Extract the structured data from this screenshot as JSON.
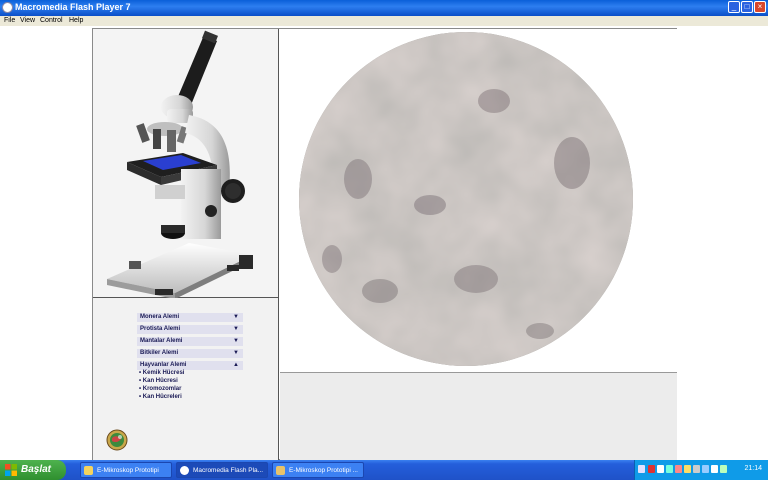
{
  "window": {
    "title": "Macromedia Flash Player 7",
    "buttons": {
      "minimize": "_",
      "maximize": "□",
      "close": "×"
    }
  },
  "menubar": {
    "items": [
      "File",
      "View",
      "Control",
      "Help"
    ]
  },
  "flash": {
    "menu": {
      "categories": [
        {
          "label": "Monera Alemi",
          "arrow": "▼"
        },
        {
          "label": "Protista Alemi",
          "arrow": "▼"
        },
        {
          "label": "Mantalar Alemi",
          "arrow": "▼"
        },
        {
          "label": "Bitkiler Alemi",
          "arrow": "▼"
        },
        {
          "label": "Hayvanlar Alemi",
          "arrow": "▲"
        }
      ],
      "subitems": [
        "• Kemik Hücresi",
        "• Kan Hücresi",
        "• Kromozomlar",
        "• Kan Hücreleri"
      ]
    }
  },
  "taskbar": {
    "start_label": "Başlat",
    "tasks": [
      {
        "label": "E-Mikroskop Prototipi",
        "active": false
      },
      {
        "label": "Macromedia Flash Pla...",
        "active": true
      },
      {
        "label": "E-Mikroskop Prototipi ...",
        "active": false
      }
    ],
    "clock": "21:14"
  },
  "colors": {
    "titlebar": "#0a5fd8",
    "taskbar": "#245edb",
    "start": "#3c9c3c",
    "tray": "#0f9be8",
    "view_circle": "#8f8e88"
  }
}
